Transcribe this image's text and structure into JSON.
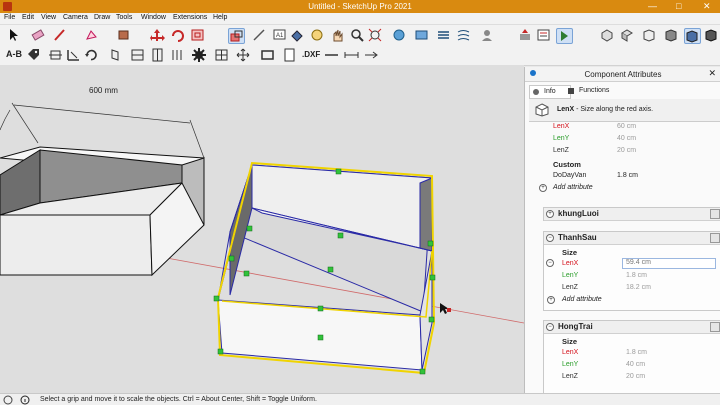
{
  "app": {
    "title": "Untitled - SketchUp Pro 2021"
  },
  "menu": [
    "File",
    "Edit",
    "View",
    "Camera",
    "Draw",
    "Tools",
    "Window",
    "Extensions",
    "Help"
  ],
  "toolbar2": {
    "ab_label": "A-B",
    "dxf_label": ".DXF"
  },
  "viewport": {
    "dimension_label": "600 mm"
  },
  "panel": {
    "title": "Component Attributes",
    "tabs": {
      "info": "Info",
      "functions": "Functions"
    },
    "info_line": {
      "attr": "LenX",
      "desc": " - Size along the red axis."
    },
    "top_rows": [
      {
        "label": "LenX",
        "value": "60 cm",
        "color": "red"
      },
      {
        "label": "LenY",
        "value": "40 cm",
        "color": "green"
      },
      {
        "label": "LenZ",
        "value": "20 cm",
        "color": "blue"
      }
    ],
    "custom_label": "Custom",
    "custom_row": {
      "label": "DoDayVan",
      "value": "1.8 cm"
    },
    "add_attribute": "Add attribute",
    "sections": [
      {
        "name": "khungLuoi",
        "expanded": false
      },
      {
        "name": "ThanhSau",
        "expanded": true,
        "size_label": "Size",
        "rows": [
          {
            "label": "LenX",
            "value": "59.4 cm",
            "color": "red",
            "editing": true
          },
          {
            "label": "LenY",
            "value": "1.8 cm",
            "color": "green"
          },
          {
            "label": "LenZ",
            "value": "18.2 cm",
            "color": "blue"
          }
        ],
        "add_attribute": "Add attribute"
      },
      {
        "name": "HongTrai",
        "expanded": true,
        "size_label": "Size",
        "rows": [
          {
            "label": "LenX",
            "value": "1.8 cm",
            "color": "red"
          },
          {
            "label": "LenY",
            "value": "40 cm",
            "color": "green"
          },
          {
            "label": "LenZ",
            "value": "20 cm",
            "color": "blue"
          }
        ]
      }
    ]
  },
  "status": {
    "text": "Select a grip and move it to scale the objects. Ctrl = About Center, Shift = Toggle Uniform."
  }
}
